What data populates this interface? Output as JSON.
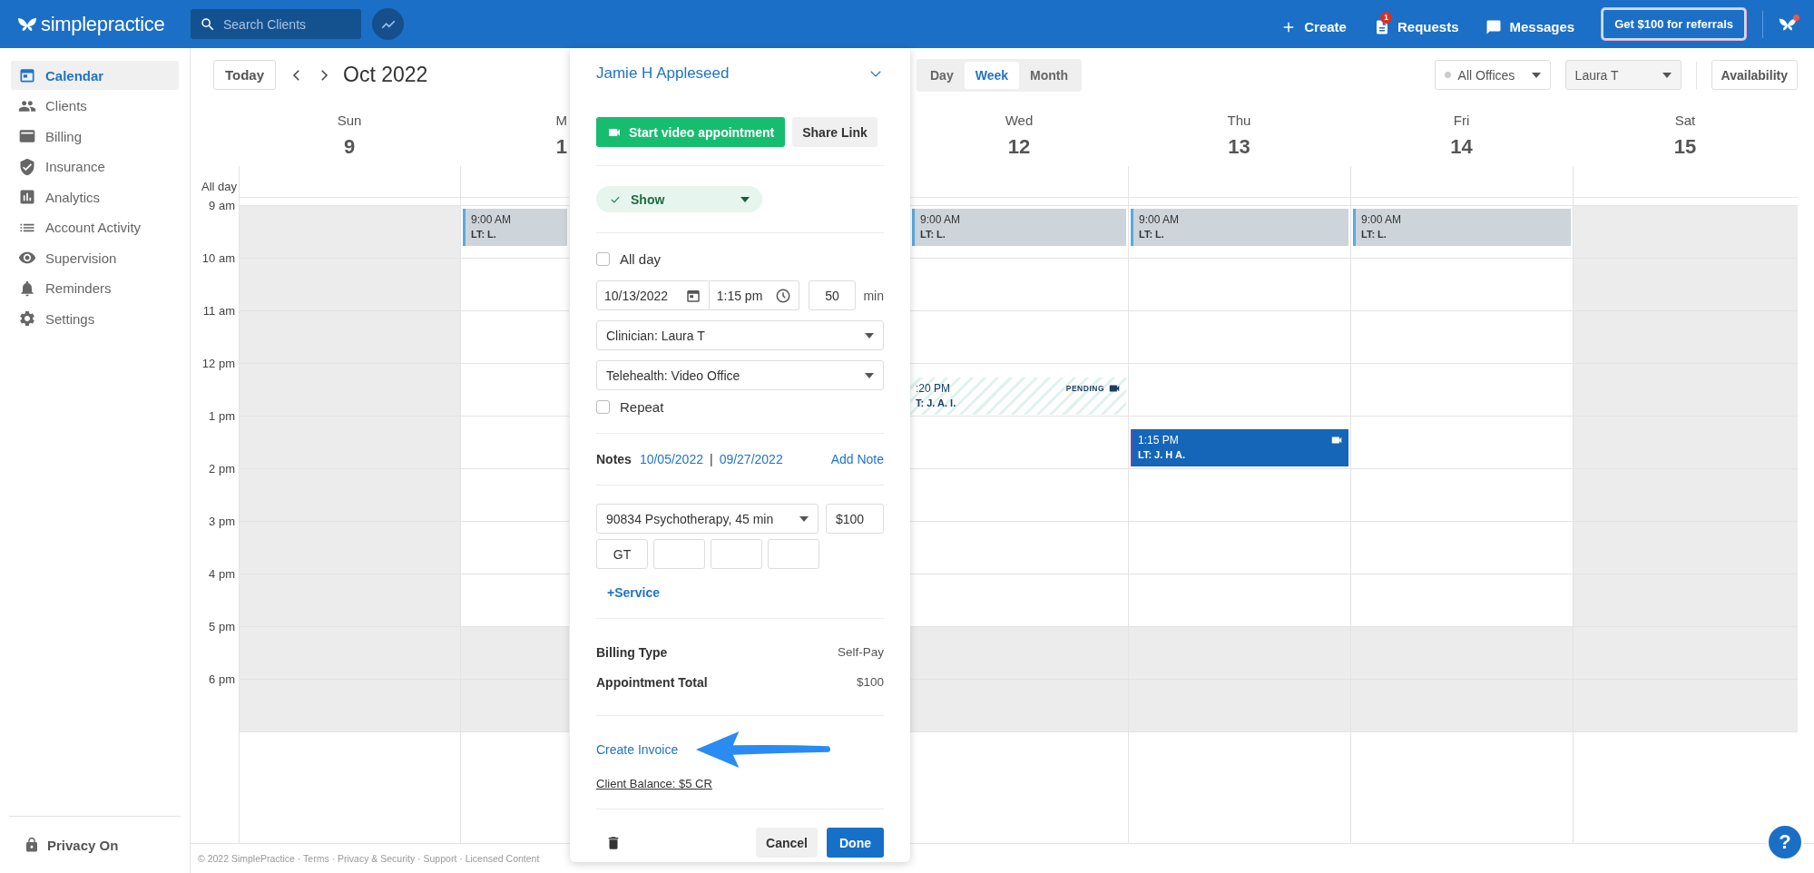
{
  "topbar": {
    "logo": "simplepractice",
    "search": {
      "placeholder": "Search Clients"
    },
    "actions": [
      {
        "label": "Create",
        "kind": "create"
      },
      {
        "label": "Requests",
        "kind": "requests",
        "badge": "1"
      },
      {
        "label": "Messages",
        "kind": "messages"
      }
    ],
    "referral": "Get $100 for referrals"
  },
  "sidebar": {
    "items": [
      {
        "label": "Calendar",
        "kind": "calendar",
        "selected": true
      },
      {
        "label": "Clients",
        "kind": "clients",
        "selected": false
      },
      {
        "label": "Billing",
        "kind": "billing",
        "selected": false
      },
      {
        "label": "Insurance",
        "kind": "insurance",
        "selected": false
      },
      {
        "label": "Analytics",
        "kind": "analytics",
        "selected": false
      },
      {
        "label": "Account Activity",
        "kind": "activity",
        "selected": false
      },
      {
        "label": "Supervision",
        "kind": "supervision",
        "selected": false
      },
      {
        "label": "Reminders",
        "kind": "reminders",
        "selected": false
      },
      {
        "label": "Settings",
        "kind": "settings",
        "selected": false
      }
    ],
    "privacy": "Privacy On"
  },
  "calendar": {
    "today": "Today",
    "month": "Oct 2022",
    "views": [
      {
        "label": "Day",
        "selected": false
      },
      {
        "label": "Week",
        "selected": true
      },
      {
        "label": "Month",
        "selected": false
      }
    ],
    "filters": [
      {
        "label": "All Offices",
        "kind": "office"
      },
      {
        "label": "Laura T",
        "kind": "clinician"
      }
    ],
    "availability": "Availability",
    "all_day": "All day",
    "days": [
      {
        "name": "Sun",
        "number": "9",
        "kind": "full"
      },
      {
        "name": "M",
        "number": "1",
        "kind": "cut"
      },
      {
        "name": "Wed",
        "number": "12",
        "kind": "full"
      },
      {
        "name": "Thu",
        "number": "13",
        "kind": "full"
      },
      {
        "name": "Fri",
        "number": "14",
        "kind": "full"
      },
      {
        "name": "Sat",
        "number": "15",
        "kind": "full"
      }
    ],
    "rows": [
      {
        "label": "9 am",
        "cells": [
          {
            "shaded": true
          },
          {
            "shaded": false,
            "events": [
              {
                "time": "9:00 AM",
                "title": "LT: L.",
                "kind": "block"
              }
            ]
          },
          {
            "shaded": false,
            "events": [
              {
                "time": "9:00 AM",
                "title": "LT: L.",
                "kind": "block"
              }
            ]
          },
          {
            "shaded": false,
            "events": [
              {
                "time": "9:00 AM",
                "title": "LT: L.",
                "kind": "block"
              }
            ]
          },
          {
            "shaded": false,
            "events": [
              {
                "time": "9:00 AM",
                "title": "LT: L.",
                "kind": "block"
              }
            ]
          },
          {
            "shaded": true
          }
        ]
      },
      {
        "label": "10 am",
        "cells": [
          {
            "shaded": true
          },
          {
            "shaded": false
          },
          {
            "shaded": false
          },
          {
            "shaded": false
          },
          {
            "shaded": false
          },
          {
            "shaded": true
          }
        ]
      },
      {
        "label": "11 am",
        "cells": [
          {
            "shaded": true
          },
          {
            "shaded": false
          },
          {
            "shaded": false
          },
          {
            "shaded": false
          },
          {
            "shaded": false
          },
          {
            "shaded": true
          }
        ]
      },
      {
        "label": "12 pm",
        "cells": [
          {
            "shaded": true
          },
          {
            "shaded": false
          },
          {
            "shaded": false,
            "events": [
              {
                "time": ":20 PM",
                "title": "T: J. A. I.",
                "kind": "pending",
                "badge": "PENDING"
              }
            ]
          },
          {
            "shaded": false
          },
          {
            "shaded": false
          },
          {
            "shaded": true
          }
        ]
      },
      {
        "label": "1 pm",
        "cells": [
          {
            "shaded": true
          },
          {
            "shaded": false
          },
          {
            "shaded": false
          },
          {
            "shaded": false,
            "events": [
              {
                "time": "1:15 PM",
                "title": "LT: J. H A.",
                "kind": "video"
              }
            ]
          },
          {
            "shaded": false
          },
          {
            "shaded": true
          }
        ]
      },
      {
        "label": "2 pm",
        "cells": [
          {
            "shaded": true
          },
          {
            "shaded": false
          },
          {
            "shaded": false
          },
          {
            "shaded": false
          },
          {
            "shaded": false
          },
          {
            "shaded": true
          }
        ]
      },
      {
        "label": "3 pm",
        "cells": [
          {
            "shaded": true
          },
          {
            "shaded": false
          },
          {
            "shaded": false
          },
          {
            "shaded": false
          },
          {
            "shaded": false
          },
          {
            "shaded": true
          }
        ]
      },
      {
        "label": "4 pm",
        "cells": [
          {
            "shaded": true
          },
          {
            "shaded": false
          },
          {
            "shaded": false
          },
          {
            "shaded": false
          },
          {
            "shaded": false
          },
          {
            "shaded": true
          }
        ]
      },
      {
        "label": "5 pm",
        "cells": [
          {
            "shaded": true
          },
          {
            "shaded": true
          },
          {
            "shaded": true
          },
          {
            "shaded": true
          },
          {
            "shaded": true
          },
          {
            "shaded": true
          }
        ]
      },
      {
        "label": "6 pm",
        "cells": [
          {
            "shaded": true
          },
          {
            "shaded": true
          },
          {
            "shaded": true
          },
          {
            "shaded": true
          },
          {
            "shaded": true
          },
          {
            "shaded": true
          }
        ]
      }
    ],
    "footer": "© 2022 SimplePractice · Terms · Privacy & Security · Support · Licensed Content",
    "help": "?"
  },
  "popup": {
    "client": "Jamie H Appleseed",
    "video_button": "Start video appointment",
    "share_button": "Share Link",
    "status": "Show",
    "all_day": {
      "label": "All day",
      "checked": false
    },
    "date": "10/13/2022",
    "time": "1:15 pm",
    "duration": "50",
    "duration_unit": "min",
    "clinician": "Clinician: Laura T",
    "location": "Telehealth: Video Office",
    "repeat": {
      "label": "Repeat",
      "checked": false
    },
    "notes": {
      "label": "Notes",
      "links": [
        "10/05/2022",
        "09/27/2022"
      ],
      "separator": "|",
      "add": "Add Note"
    },
    "service": {
      "code": "90834 Psychotherapy, 45 min",
      "fee": "$100",
      "modifiers": [
        {
          "kind": "filled",
          "value": "GT"
        },
        {
          "kind": "empty"
        },
        {
          "kind": "empty"
        },
        {
          "kind": "empty"
        }
      ],
      "add": "+Service"
    },
    "billing": [
      {
        "label": "Billing Type",
        "value": "Self-Pay"
      },
      {
        "label": "Appointment Total",
        "value": "$100"
      }
    ],
    "invoice": "Create Invoice",
    "balance": "Client Balance: $5 CR",
    "cancel": "Cancel",
    "done": "Done"
  }
}
